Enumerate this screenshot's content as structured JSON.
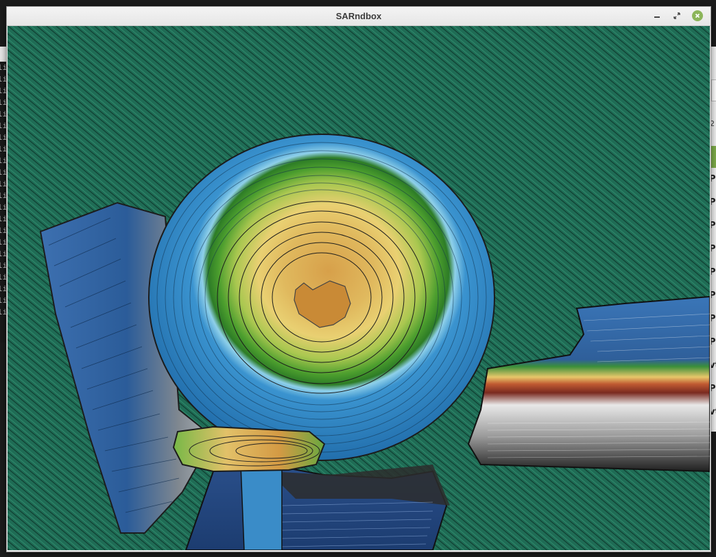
{
  "window": {
    "title": "SARndbox"
  },
  "background_terminal": {
    "lines": [
      "li",
      "li",
      "li",
      "li",
      "li",
      "li",
      "li",
      "li",
      "li",
      "li",
      "li",
      "li",
      "li",
      "li",
      "li",
      "li",
      "li",
      "li",
      "li",
      "li",
      "li",
      "li"
    ]
  },
  "background_window": {
    "field_value": "2",
    "items": [
      "P",
      "P",
      "P",
      "P",
      "P",
      "P",
      "P",
      "P",
      "vt",
      "P",
      "vt"
    ]
  },
  "colors": {
    "water_bg": "#1e6d55",
    "deep_blue": "#2f86c4",
    "green": "#4c9e2e",
    "sand": "#d8a84e",
    "close_button": "#8cb55a"
  }
}
